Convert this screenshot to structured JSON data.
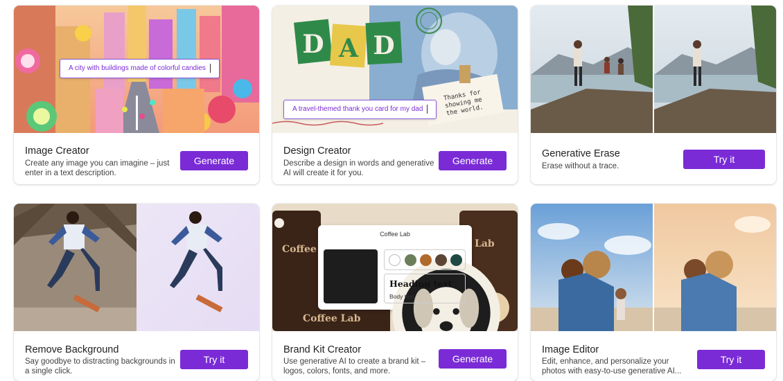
{
  "cards": [
    {
      "title": "Image Creator",
      "desc": "Create any image you can imagine – just enter in a text description.",
      "button": "Generate",
      "prompt": "A city with buildings made of colorful candies"
    },
    {
      "title": "Design Creator",
      "desc": "Describe a design in words and generative AI will create it for you.",
      "button": "Generate",
      "prompt": "A travel-themed thank you card for my dad",
      "card_word": "DAD",
      "note_text": "Thanks for showing me the world."
    },
    {
      "title": "Generative Erase",
      "desc": "Erase without a trace.",
      "button": "Try it"
    },
    {
      "title": "Remove Background",
      "desc": "Say goodbye to distracting backgrounds in a single click.",
      "button": "Try it"
    },
    {
      "title": "Brand Kit Creator",
      "desc": "Use generative AI to create a brand kit – logos, colors, fonts, and more.",
      "button": "Generate",
      "panel_title": "Coffee Lab",
      "heading_text": "Heading text",
      "body_text": "Body text",
      "bg_text_left": "Coffee Lab",
      "bg_text_right": "Lab",
      "bg_text_bottom": "Coffee Lab",
      "swatch_colors": [
        "#ffffff",
        "#6b7f5a",
        "#b06a2c",
        "#5b4535",
        "#1f4a44"
      ]
    },
    {
      "title": "Image Editor",
      "desc": "Edit, enhance, and personalize your photos with easy-to-use generative AI...",
      "button": "Try it"
    }
  ],
  "colors": {
    "accent": "#7a2bd6"
  }
}
